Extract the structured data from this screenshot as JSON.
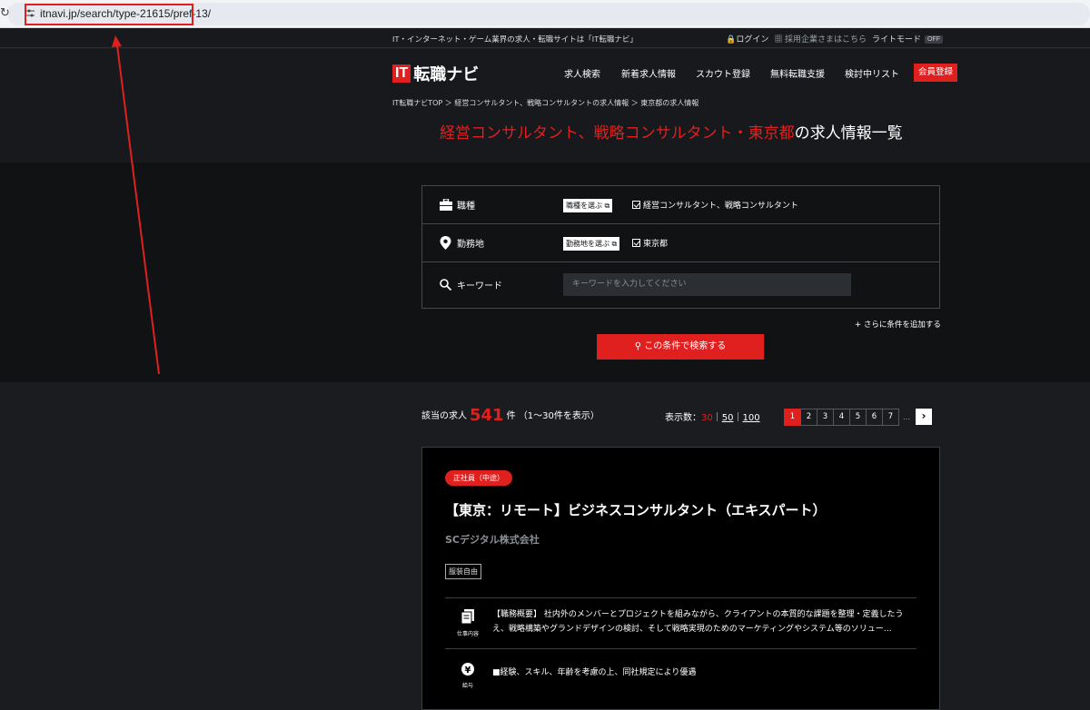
{
  "browser": {
    "url": "itnavi.jp/search/type-21615/pref-13/"
  },
  "topbar": {
    "tagline": "IT・インターネット・ゲーム業界の求人・転職サイトは「IT転職ナビ」",
    "login": "ログイン",
    "employer": "採用企業さまはこちら",
    "light_mode": "ライトモード",
    "toggle": "OFF"
  },
  "header": {
    "logo_it": "IT",
    "logo_name": "転職ナビ",
    "nav": [
      "求人検索",
      "新着求人情報",
      "スカウト登録",
      "無料転職支援",
      "検討中リスト"
    ],
    "register": "会員登録"
  },
  "breadcrumb": "IT転職ナビTOP ＞ 経営コンサルタント、戦略コンサルタントの求人情報 ＞ 東京都の求人情報",
  "page_title": {
    "highlight": "経営コンサルタント、戦略コンサルタント・東京都",
    "rest": "の求人情報一覧"
  },
  "search": {
    "rows": [
      {
        "label": "職種",
        "button": "職種を選ぶ",
        "selected": "経営コンサルタント、戦略コンサルタント"
      },
      {
        "label": "勤務地",
        "button": "勤務地を選ぶ",
        "selected": "東京都"
      }
    ],
    "keyword_label": "キーワード",
    "keyword_placeholder": "キーワードを入力してください",
    "add_condition": "さらに条件を追加する",
    "submit": "この条件で検索する"
  },
  "results": {
    "prefix": "該当の求人",
    "count": "541",
    "suffix": "件",
    "range": "（1〜30件を表示）",
    "perpage_label": "表示数：",
    "perpage_options": [
      "30",
      "50",
      "100"
    ],
    "pages": [
      "1",
      "2",
      "3",
      "4",
      "5",
      "6",
      "7"
    ],
    "dots": "…"
  },
  "job": {
    "badge": "正社員（中途）",
    "title": "【東京：リモート】ビジネスコンサルタント（エキスパート）",
    "company": "SCデジタル株式会社",
    "tag": "服装自由",
    "work_caption": "仕事内容",
    "work_text": "【職務概要】 社内外のメンバーとプロジェクトを組みながら、クライアントの本質的な課題を整理・定義したうえ、戦略構築やグランドデザインの検討、そして戦略実現のためのマーケティングやシステム等のソリュー…",
    "salary_caption": "給与",
    "salary_text": "■経験、スキル、年齢を考慮の上、同社規定により優遇"
  },
  "colors": {
    "accent": "#e0201f",
    "background": "#1a1c1f"
  }
}
